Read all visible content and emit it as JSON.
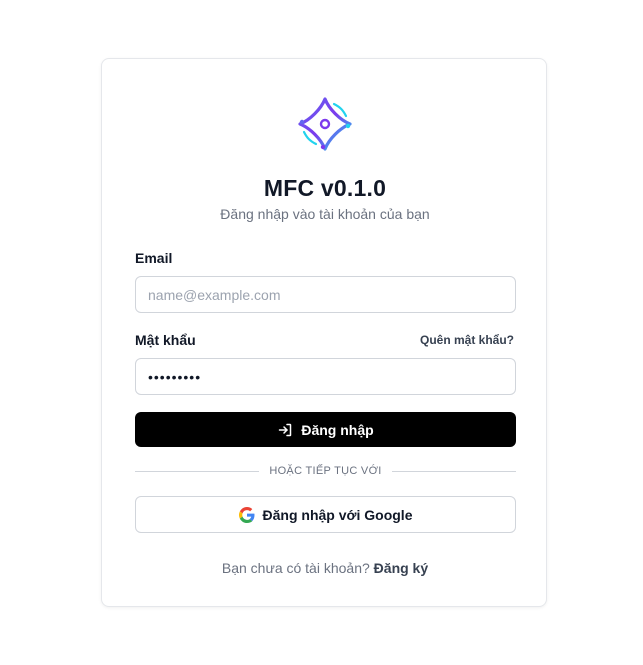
{
  "app": {
    "title": "MFC v0.1.0",
    "subtitle": "Đăng nhập vào tài khoản của bạn",
    "logo_icon": "sparkle-diamond-icon"
  },
  "form": {
    "email_label": "Email",
    "email_placeholder": "name@example.com",
    "email_value": "",
    "password_label": "Mật khẩu",
    "password_value": "•••••••••",
    "forgot_label": "Quên mật khẩu?",
    "login_label": "Đăng nhập",
    "login_icon": "log-in-icon"
  },
  "divider": {
    "text": "HOẶC TIẾP TỤC VỚI"
  },
  "google": {
    "label": "Đăng nhập với Google",
    "icon": "google-icon"
  },
  "signup": {
    "prompt": "Bạn chưa có tài khoản?",
    "link": "Đăng ký"
  },
  "colors": {
    "primary_button": "#000000",
    "border": "#d1d5db",
    "muted_text": "#6b7280",
    "logo_purple": "#7c3aed",
    "logo_cyan": "#22d3ee"
  }
}
